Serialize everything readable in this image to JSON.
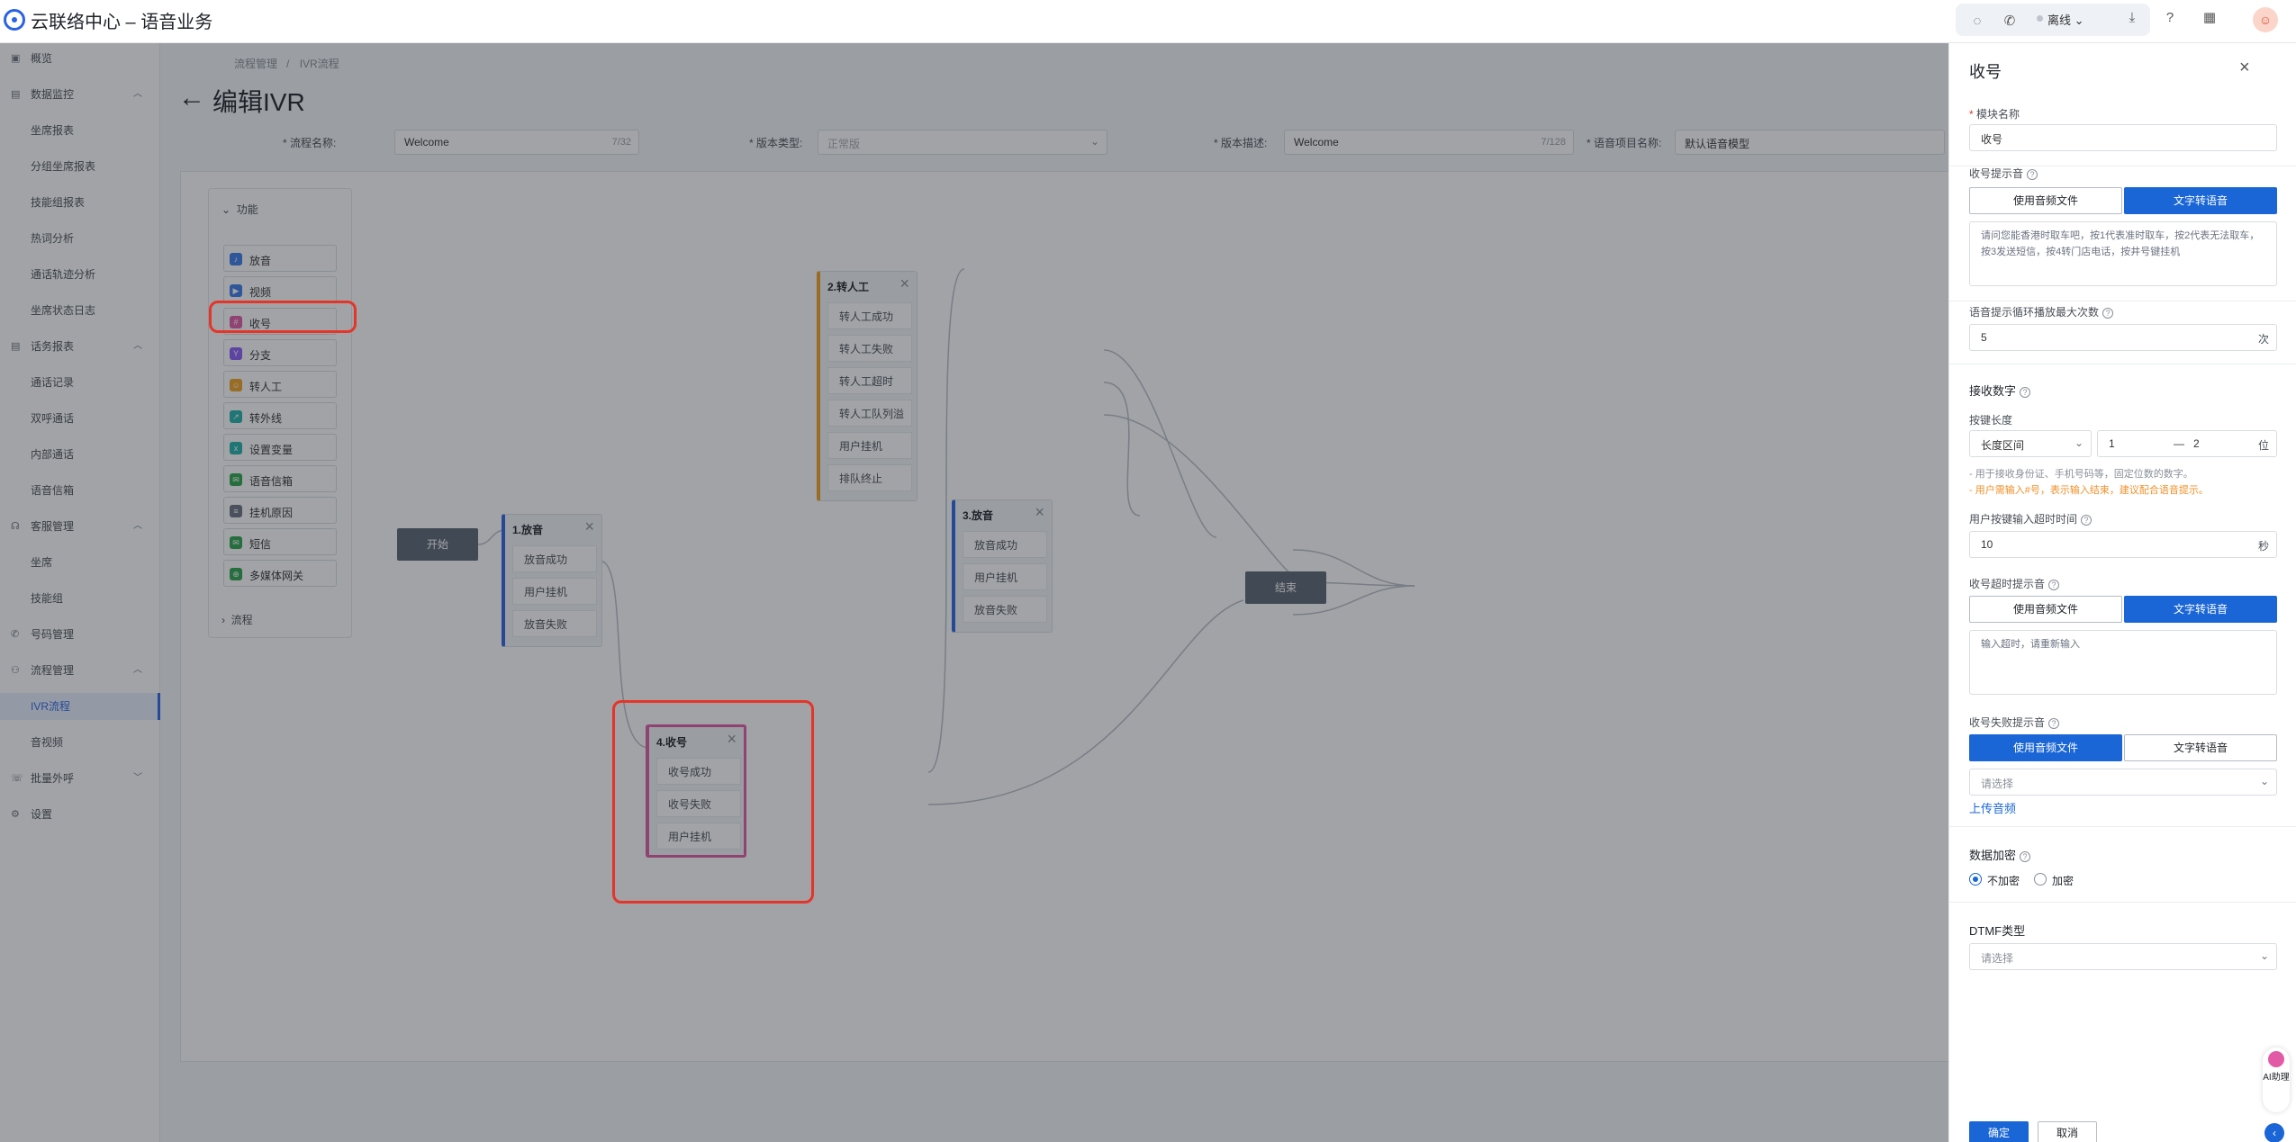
{
  "header": {
    "app_title": "云联络中心 – 语音业务",
    "status": "离线",
    "icons": [
      "chat-icon",
      "phone-icon",
      "chevron-down-icon",
      "download-icon",
      "help-icon",
      "apps-icon"
    ]
  },
  "sidebar": {
    "items": [
      {
        "label": "概览",
        "type": "group"
      },
      {
        "label": "数据监控",
        "type": "group"
      },
      {
        "label": "坐席报表",
        "type": "sub"
      },
      {
        "label": "分组坐席报表",
        "type": "sub"
      },
      {
        "label": "技能组报表",
        "type": "sub"
      },
      {
        "label": "热词分析",
        "type": "sub"
      },
      {
        "label": "通话轨迹分析",
        "type": "sub"
      },
      {
        "label": "坐席状态日志",
        "type": "sub"
      },
      {
        "label": "话务报表",
        "type": "group"
      },
      {
        "label": "通话记录",
        "type": "sub"
      },
      {
        "label": "双呼通话",
        "type": "sub"
      },
      {
        "label": "内部通话",
        "type": "sub"
      },
      {
        "label": "语音信箱",
        "type": "sub"
      },
      {
        "label": "客服管理",
        "type": "group"
      },
      {
        "label": "坐席",
        "type": "sub"
      },
      {
        "label": "技能组",
        "type": "sub"
      },
      {
        "label": "号码管理",
        "type": "group"
      },
      {
        "label": "流程管理",
        "type": "group"
      },
      {
        "label": "IVR流程",
        "type": "sub",
        "active": true
      },
      {
        "label": "音视频",
        "type": "sub"
      },
      {
        "label": "批量外呼",
        "type": "group"
      },
      {
        "label": "设置",
        "type": "group"
      }
    ]
  },
  "breadcrumb": [
    "流程管理",
    "IVR流程"
  ],
  "page_title": "编辑IVR",
  "form": {
    "flow_name_label": "* 流程名称:",
    "flow_name_value": "Welcome",
    "flow_name_count": "7/32",
    "version_type_label": "* 版本类型:",
    "version_type_placeholder": "正常版",
    "version_desc_label": "* 版本描述:",
    "version_desc_value": "Welcome",
    "version_desc_count": "7/128",
    "voice_project_label": "* 语音项目名称:",
    "voice_project_value": "默认语音模型"
  },
  "palette": {
    "head": "功能",
    "items": [
      {
        "label": "放音",
        "color": "#3b7be8",
        "glyph": "♪"
      },
      {
        "label": "视频",
        "color": "#3b7be8",
        "glyph": "▶"
      },
      {
        "label": "收号",
        "color": "#e25aa6",
        "glyph": "#"
      },
      {
        "label": "分支",
        "color": "#8b5cf6",
        "glyph": "Y"
      },
      {
        "label": "转人工",
        "color": "#f0a020",
        "glyph": "☺"
      },
      {
        "label": "转外线",
        "color": "#20b2aa",
        "glyph": "↗"
      },
      {
        "label": "设置变量",
        "color": "#20b2aa",
        "glyph": "x"
      },
      {
        "label": "语音信箱",
        "color": "#2ea44f",
        "glyph": "✉"
      },
      {
        "label": "挂机原因",
        "color": "#6b7280",
        "glyph": "≡"
      },
      {
        "label": "短信",
        "color": "#2ea44f",
        "glyph": "✉"
      },
      {
        "label": "多媒体网关",
        "color": "#2ea44f",
        "glyph": "⊕"
      }
    ],
    "flow": "流程"
  },
  "nodes": {
    "start": "开始",
    "end": "结束",
    "play": {
      "title": "1.放音",
      "rows": [
        "放音成功",
        "用户挂机",
        "放音失败"
      ],
      "color": "#2a64e3"
    },
    "transfer": {
      "title": "2.转人工",
      "rows": [
        "转人工成功",
        "转人工失败",
        "转人工超时",
        "转人工队列溢出",
        "用户挂机",
        "排队终止"
      ],
      "color": "#f0a020"
    },
    "play3": {
      "title": "3.放音",
      "rows": [
        "放音成功",
        "用户挂机",
        "放音失败"
      ],
      "color": "#2a64e3"
    },
    "collect": {
      "title": "4.收号",
      "rows": [
        "收号成功",
        "收号失败",
        "用户挂机"
      ],
      "color": "#e25aa6"
    }
  },
  "drawer": {
    "title": "收号",
    "module_name_label": "模块名称",
    "module_name_value": "收号",
    "prompt_label": "收号提示音",
    "btn_audio": "使用音频文件",
    "btn_tts": "文字转语音",
    "prompt_text": "请问您能香港时取车吧，按1代表准时取车，按2代表无法取车，按3发送短信，按4转门店电话，按井号键挂机",
    "loop_label": "语音提示循环播放最大次数",
    "loop_value": "5",
    "loop_unit": "次",
    "receive_digits_title": "接收数字",
    "key_length_label": "按键长度",
    "key_length_mode": "长度区间",
    "key_min": "1",
    "key_sep": "—",
    "key_max": "2",
    "key_unit": "位",
    "hint1": "- 用于接收身份证、手机号码等，固定位数的数字。",
    "hint2": "- 用户需输入#号，表示输入结束，建议配合语音提示。",
    "timeout_label": "用户按键输入超时时间",
    "timeout_value": "10",
    "timeout_unit": "秒",
    "timeout_prompt_label": "收号超时提示音",
    "timeout_placeholder": "输入超时，请重新输入",
    "fail_prompt_label": "收号失败提示音",
    "fail_select_placeholder": "请选择",
    "upload_link": "上传音频",
    "encrypt_label": "数据加密",
    "encrypt_off": "不加密",
    "encrypt_on": "加密",
    "dtmf_label": "DTMF类型",
    "dtmf_placeholder": "请选择",
    "confirm": "确定",
    "cancel": "取消",
    "ai_badge": "AI助理"
  }
}
